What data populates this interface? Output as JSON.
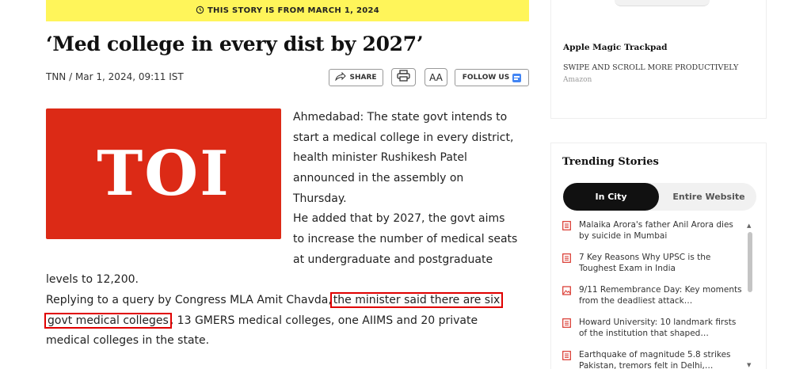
{
  "banner": {
    "icon": "clock-history-icon",
    "text": "THIS STORY IS FROM MARCH 1, 2024"
  },
  "article": {
    "title": "‘Med college in every dist by 2027’",
    "byline": "TNN / Mar 1, 2024, 09:11 IST",
    "image_text": "TOI",
    "lines": [
      "Ahmedabad: The state govt intends to",
      "start a medical college in every district,",
      "health minister Rushikesh Patel",
      "announced in the assembly on",
      "Thursday.",
      "He added that by 2027, the govt aims",
      "to increase the number of medical seats",
      "at undergraduate and postgraduate",
      "levels to 12,200.",
      "Replying to a query by Congress MLA Amit Chavda,",
      "the minister said there are six",
      "govt medical colleges",
      ", 13 GMERS medical colleges, one AIIMS and 20 private",
      "medical colleges in the state."
    ]
  },
  "toolbar": {
    "share_label": "SHARE",
    "font_label": "AA",
    "follow_label": "FOLLOW US"
  },
  "ad": {
    "title": "Apple Magic Trackpad",
    "subtitle": "SWIPE AND SCROLL MORE PRODUCTIVELY",
    "source": "Amazon"
  },
  "trending": {
    "heading": "Trending Stories",
    "tabs": [
      "In City",
      "Entire Website"
    ],
    "active_tab": "In City",
    "items": [
      {
        "icon": "article-icon",
        "text": "Malaika Arora's father Anil Arora dies by suicide in Mumbai"
      },
      {
        "icon": "article-icon",
        "text": "7 Key Reasons Why UPSC is the Toughest Exam in India"
      },
      {
        "icon": "photo-icon",
        "text": "9/11 Remembrance Day: Key moments from the deadliest attack…"
      },
      {
        "icon": "article-icon",
        "text": "Howard University: 10 landmark firsts of the institution that shaped…"
      },
      {
        "icon": "article-icon",
        "text": "Earthquake of magnitude 5.8 strikes Pakistan, tremors felt in Delhi,…"
      }
    ]
  },
  "colors": {
    "banner": "#fff55a",
    "toi_red": "#dc2a16",
    "highlight_box": "#e00000",
    "link_icon": "#d9342b"
  }
}
